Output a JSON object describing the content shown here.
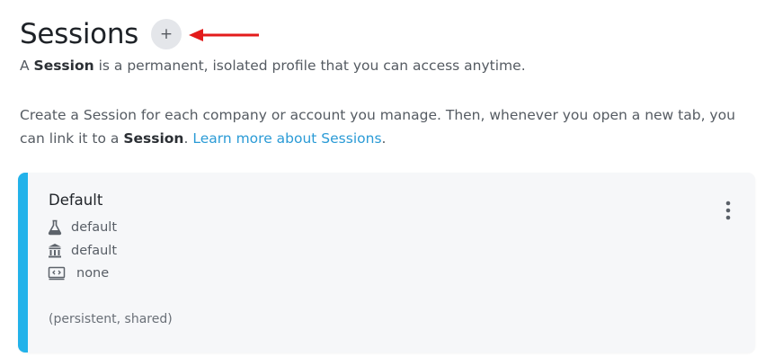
{
  "header": {
    "title": "Sessions",
    "add_button_label": "+"
  },
  "description": {
    "line1_prefix": "A ",
    "line1_bold": "Session",
    "line1_suffix": " is a permanent, isolated profile that you can access anytime.",
    "line2_prefix": "Create a Session for each company or account you manage. Then, whenever you open a new tab, you can link it to a ",
    "line2_bold": "Session",
    "line2_mid": ". ",
    "learn_more_link": "Learn more about Sessions",
    "line2_end": "."
  },
  "session_card": {
    "name": "Default",
    "environment": "default",
    "organization": "default",
    "extension": "none",
    "footer": "(persistent, shared)",
    "icons": [
      "flask-icon",
      "building-icon",
      "browser-code-icon",
      "more-vertical-icon"
    ]
  },
  "colors": {
    "accent": "#22b2ea",
    "link": "#2b9bd6",
    "arrow": "#e31b1b",
    "card_bg": "#f6f7f9"
  }
}
